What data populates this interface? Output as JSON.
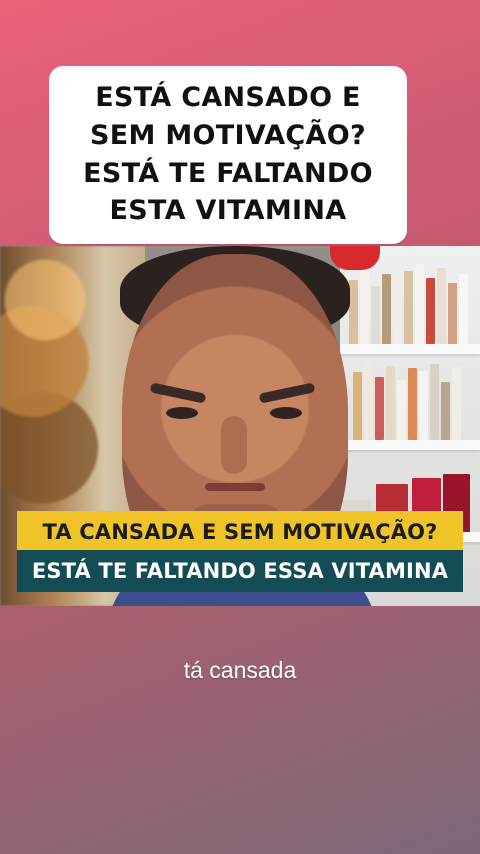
{
  "title_card": {
    "lines": [
      "ESTÁ CANSADO E",
      "SEM MOTIVAÇÃO?",
      "ESTÁ TE FALTANDO",
      "ESTA VITAMINA"
    ]
  },
  "video": {
    "captions": {
      "primary": "TA CANSADA E SEM MOTIVAÇÃO?",
      "secondary": "ESTÁ TE FALTANDO ESSA VITAMINA"
    }
  },
  "subtitle": "tá cansada",
  "colors": {
    "background_gradient_top": "#ea6379",
    "background_gradient_bottom": "#7c6878",
    "title_card_bg": "#ffffff",
    "caption_primary_bg": "#f0c328",
    "caption_secondary_bg": "#144c55"
  }
}
